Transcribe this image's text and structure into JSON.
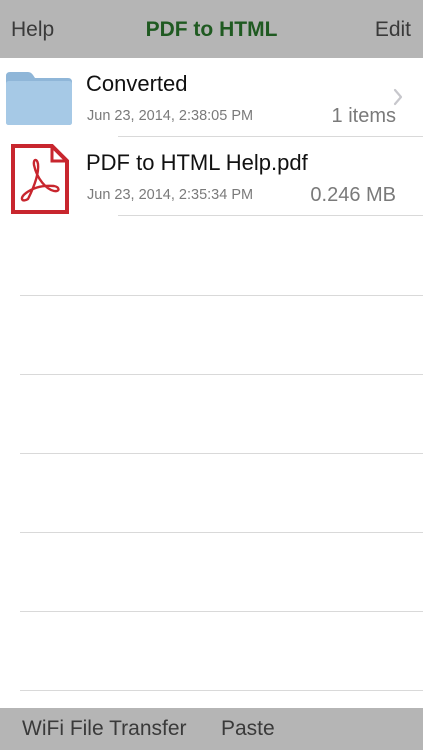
{
  "navbar": {
    "left_label": "Help",
    "title": "PDF to HTML",
    "right_label": "Edit",
    "title_color": "#1f5a21"
  },
  "files": [
    {
      "name": "Converted",
      "date": "Jun 23, 2014, 2:38:05 PM",
      "meta": "1 items",
      "icon": "folder-icon",
      "has_chevron": true
    },
    {
      "name": "PDF to HTML Help.pdf",
      "date": "Jun 23, 2014, 2:35:34 PM",
      "meta": "0.246 MB",
      "icon": "pdf-file-icon",
      "has_chevron": false
    }
  ],
  "toolbar": {
    "wifi_label": "WiFi File Transfer",
    "paste_label": "Paste"
  },
  "colors": {
    "bar_background": "#b5b5b5",
    "folder": "#9fc3e0",
    "pdf_red": "#c8262e"
  }
}
